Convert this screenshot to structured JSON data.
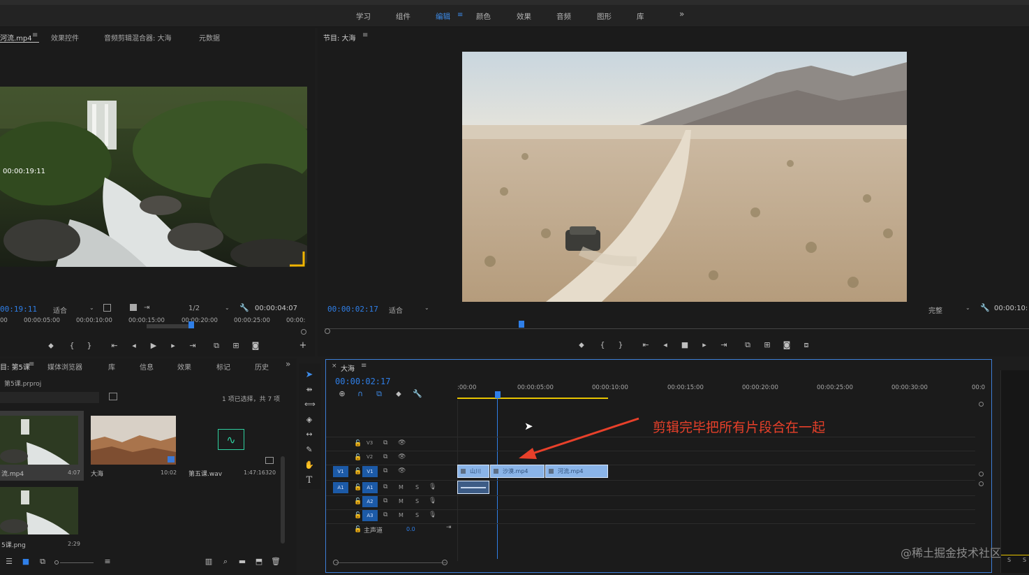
{
  "workspaces": [
    "学习",
    "组件",
    "编辑",
    "颜色",
    "效果",
    "音频",
    "图形",
    "库"
  ],
  "workspace_active_index": 2,
  "source_panel": {
    "tabs": [
      "河流.mp4",
      "效果控件",
      "音频剪辑混合器: 大海",
      "元数据"
    ],
    "overlay_timecode": "00:00:19:11",
    "timecode": "00:19:11",
    "fit": "适合",
    "resolution": "1/2",
    "duration": "00:00:04:07",
    "ruler": [
      "00",
      "00:00:05:00",
      "00:00:10:00",
      "00:00:15:00",
      "00:00:20:00",
      "00:00:25:00",
      "00:00:"
    ]
  },
  "program_panel": {
    "title": "节目: 大海",
    "timecode": "00:00:02:17",
    "fit": "适合",
    "quality": "完整",
    "duration": "00:00:10:"
  },
  "project_panel": {
    "tabs": [
      "目: 第5课",
      "媒体浏览器",
      "库",
      "信息",
      "效果",
      "标记",
      "历史"
    ],
    "project_file": "第5课.prproj",
    "selection_info": "1 项已选择，共 7 项",
    "items": [
      {
        "name": "流.mp4",
        "duration": "4:07"
      },
      {
        "name": "大海",
        "duration": "10:02"
      },
      {
        "name": "第五课.wav",
        "duration": "1:47:16320"
      },
      {
        "name": "5课.png",
        "duration": "2:29"
      }
    ]
  },
  "timeline": {
    "sequence_name": "大海",
    "timecode": "00:00:02:17",
    "ruler": [
      ":00:00",
      "00:00:05:00",
      "00:00:10:00",
      "00:00:15:00",
      "00:00:20:00",
      "00:00:25:00",
      "00:00:30:00",
      "00:0"
    ],
    "tracks": {
      "video": [
        "V3",
        "V2",
        "V1"
      ],
      "audio": [
        "A1",
        "A2",
        "A3"
      ],
      "source_v": "V1",
      "source_a": "A1",
      "mix_label": "主声道",
      "mix_value": "0.0"
    },
    "clips": [
      "山川",
      "沙漠.mp4",
      "河流.mp4"
    ],
    "annotation": "剪辑完毕把所有片段合在一起"
  },
  "watermark": "@稀土掘金技术社区",
  "colors": {
    "accent": "#2f7fe8",
    "annotation": "#e8402a",
    "clip_video": "#8ab4e8"
  }
}
